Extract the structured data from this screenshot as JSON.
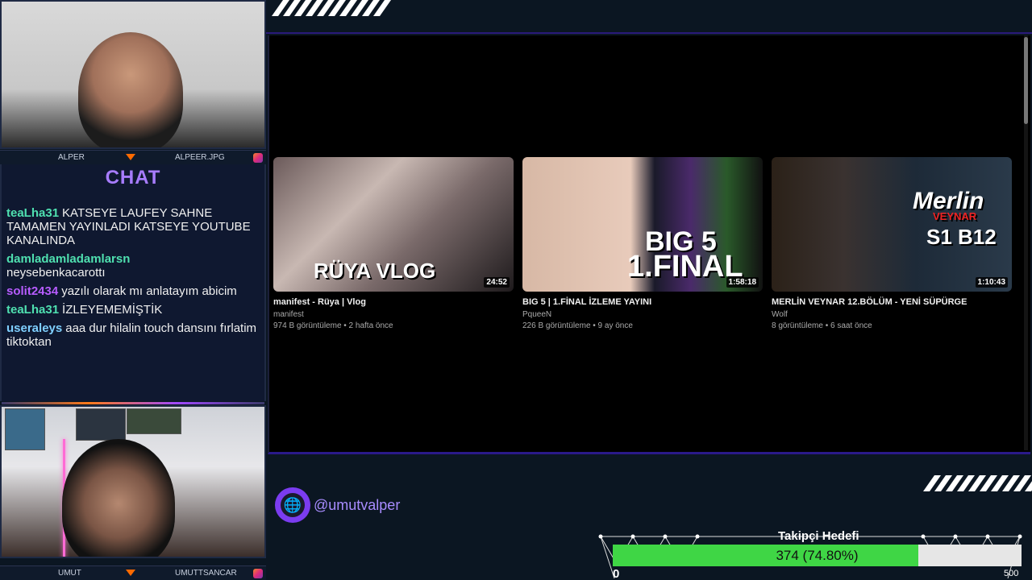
{
  "webcams": {
    "top": {
      "left_name": "ALPER",
      "right_name": "ALPEER.JPG"
    },
    "bottom": {
      "left_name": "UMUT",
      "right_name": "UMUTTSANCAR"
    }
  },
  "chat": {
    "title": "CHAT",
    "messages": [
      {
        "user": "teaLha31",
        "color": "#4fe0b0",
        "text": "KATSEYE LAUFEY SAHNE TAMAMEN YAYINLADI KATSEYE YOUTUBE KANALINDA"
      },
      {
        "user": "damladamladamlarsn",
        "color": "#4fe0b0",
        "text": "neysebenkacarottı"
      },
      {
        "user": "solit2434",
        "color": "#b75cff",
        "text": "yazılı olarak mı anlatayım abicim"
      },
      {
        "user": "teaLha31",
        "color": "#4fe0b0",
        "text": "İZLEYEMEMİŞTİK"
      },
      {
        "user": "useraleys",
        "color": "#7fd0ff",
        "text": "aaa dur hilalin touch dansını fırlatim tiktoktan"
      }
    ]
  },
  "videos": [
    {
      "thumb_text": "RÜYA VLOG",
      "duration": "24:52",
      "title": "manifest - Rüya | Vlog",
      "channel": "manifest",
      "meta": "974 B görüntüleme • 2 hafta önce"
    },
    {
      "thumb_text_1": "BIG 5",
      "thumb_text_2": "1.FINAL",
      "duration": "1:58:18",
      "title": "BIG 5 | 1.FİNAL İZLEME YAYINI",
      "channel": "PqueeN",
      "meta": "226 B görüntüleme • 9 ay önce"
    },
    {
      "thumb_text_1": "Merlin",
      "thumb_text_2": "VEYNAR",
      "thumb_text_3": "S1 B12",
      "duration": "1:10:43",
      "title": "MERLİN VEYNAR 12.BÖLÜM - YENİ SÜPÜRGE",
      "channel": "Wolf",
      "meta": "8 görüntüleme • 6 saat önce"
    }
  ],
  "social": {
    "handle": "@umutvalper",
    "icon": "globe-icon"
  },
  "follower_goal": {
    "label": "Takipçi Hedefi",
    "current": 374,
    "target": 500,
    "min": 0,
    "progress_text": "374 (74.80%)",
    "min_label": "0",
    "max_label": "500"
  },
  "colors": {
    "accent": "#a77cff",
    "goal_fill": "#3fd645",
    "border": "#2a1a8a"
  }
}
